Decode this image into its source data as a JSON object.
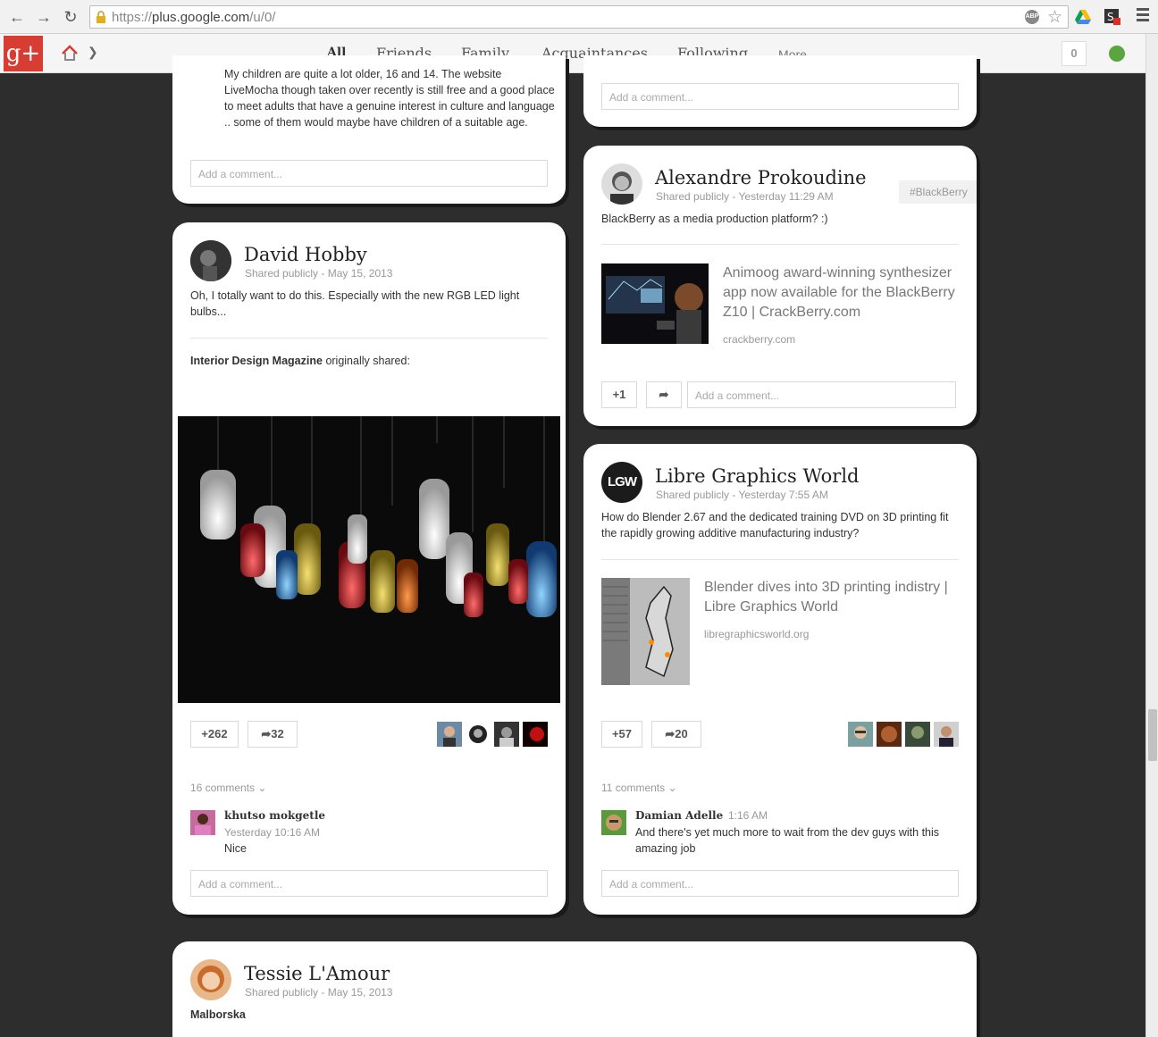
{
  "browser": {
    "url_scheme": "https://",
    "url_host": "plus.google.com",
    "url_path": "/u/0/",
    "abp_label": "ABP"
  },
  "gplus": {
    "logo": "g+",
    "tabs": [
      "All",
      "Friends",
      "Family",
      "Acquaintances",
      "Following"
    ],
    "more_label": "More",
    "notification_count": "0"
  },
  "posts": {
    "top_left": {
      "text": "My children are quite a lot older, 16 and 14. The website LiveMocha though taken over recently is still free and a good place to meet adults that have a genuine interest in culture and language .. some of them would maybe have children of a suitable age.",
      "comment_placeholder": "Add a comment..."
    },
    "top_right": {
      "comment_placeholder": "Add a comment..."
    },
    "david": {
      "author": "David Hobby",
      "shared": "Shared publicly",
      "date": "May 15, 2013",
      "text": "Oh, I totally want to do this. Especially with the new RGB LED light bulbs...",
      "origin_author": "Interior Design Magazine",
      "origin_suffix": "originally shared:",
      "plus_count": "+262",
      "share_count": "32",
      "comments_label": "16 comments",
      "commenter": "khutso mokgetle",
      "comment_time": "Yesterday 10:16 AM",
      "comment_text": "Nice",
      "comment_placeholder": "Add a comment..."
    },
    "alexandre": {
      "author": "Alexandre Prokoudine",
      "shared": "Shared publicly",
      "date": "Yesterday 11:29 AM",
      "hashtag": "#BlackBerry",
      "text": "BlackBerry as a media production platform? :)",
      "link_title": "Animoog award-winning synthesizer app now available for the BlackBerry Z10 | CrackBerry.com",
      "link_domain": "crackberry.com",
      "plus_label": "+1",
      "comment_placeholder": "Add a comment..."
    },
    "lgw": {
      "author": "Libre Graphics World",
      "avatar_text": "LGW",
      "shared": "Shared publicly",
      "date": "Yesterday 7:55 AM",
      "text": "How do Blender 2.67 and the dedicated training DVD on 3D printing fit the rapidly growing additive manufacturing industry?",
      "link_title": "Blender dives into 3D printing indistry | Libre Graphics World",
      "link_domain": "libregraphicsworld.org",
      "plus_count": "+57",
      "share_count": "20",
      "comments_label": "11 comments",
      "commenter": "Damian Adelle",
      "comment_time": "1:16 AM",
      "comment_text": "And there's yet much more to wait from the dev guys with this amazing job",
      "comment_placeholder": "Add a comment..."
    },
    "tessie": {
      "author": "Tessie L'Amour",
      "shared": "Shared publicly",
      "date": "May 15, 2013",
      "text": "Malborska"
    }
  },
  "meta_separator": "-"
}
